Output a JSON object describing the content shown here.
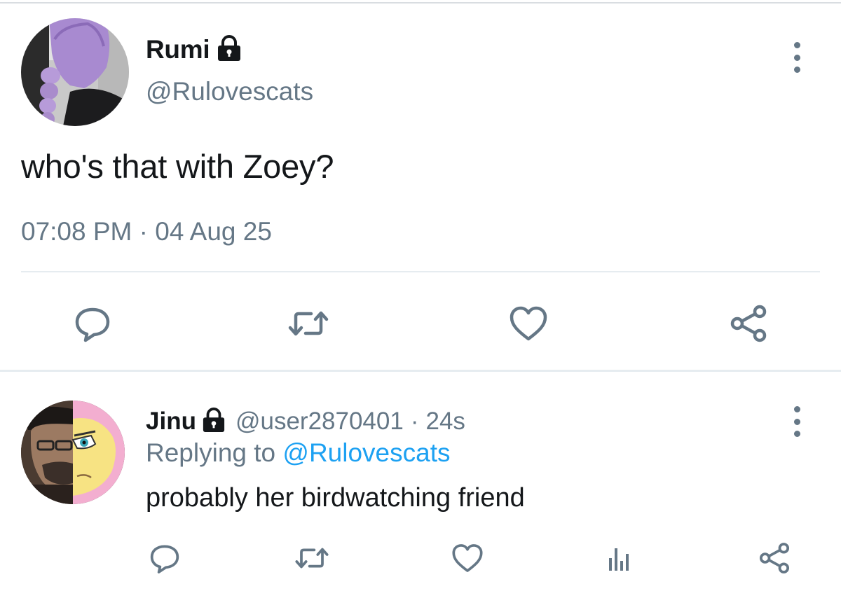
{
  "colors": {
    "text_primary": "#14171a",
    "text_secondary": "#657786",
    "link": "#1da1f2",
    "divider": "#e6ecf0"
  },
  "main_tweet": {
    "author_name": "Rumi",
    "author_handle": "@Rulovescats",
    "avatar_icon": "purple-hair-avatar",
    "locked_icon": "lock-icon",
    "text": "who's that with Zoey?",
    "timestamp": "07:08 PM · 04 Aug 25",
    "actions": [
      "reply-icon",
      "retweet-icon",
      "like-icon",
      "share-icon"
    ]
  },
  "reply_tweet": {
    "author_name": "Jinu",
    "author_handle": "@user2870401",
    "separator": "·",
    "time_ago": "24s",
    "avatar_icon": "split-face-avatar",
    "replying_prefix": "Replying to",
    "replying_handle": "@Rulovescats",
    "text": "probably her birdwatching friend",
    "actions": [
      "reply-icon",
      "retweet-icon",
      "like-icon",
      "analytics-icon",
      "share-icon"
    ]
  }
}
